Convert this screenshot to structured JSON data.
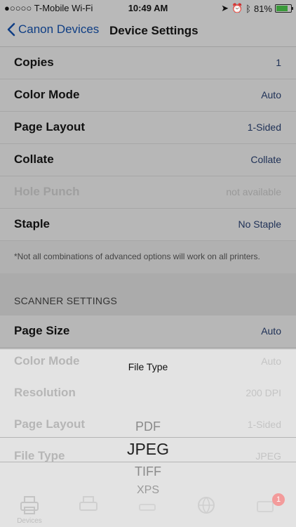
{
  "status_bar": {
    "carrier": "●○○○○ T-Mobile Wi-Fi",
    "time": "10:49 AM",
    "battery": "81%"
  },
  "nav": {
    "back_label": "Canon Devices",
    "title": "Device Settings"
  },
  "printer_rows": [
    {
      "label": "Copies",
      "value": "1"
    },
    {
      "label": "Color Mode",
      "value": "Auto"
    },
    {
      "label": "Page Layout",
      "value": "1-Sided"
    },
    {
      "label": "Collate",
      "value": "Collate"
    },
    {
      "label": "Hole Punch",
      "value": "not available"
    },
    {
      "label": "Staple",
      "value": "No Staple"
    }
  ],
  "note": "*Not all combinations of advanced options will work on all printers.",
  "scanner_section_title": "SCANNER SETTINGS",
  "scanner_rows": [
    {
      "label": "Page Size",
      "value": "Auto"
    },
    {
      "label": "Color Mode",
      "value": "Auto"
    },
    {
      "label": "Resolution",
      "value": "200 DPI"
    },
    {
      "label": "Page Layout",
      "value": "1-Sided"
    },
    {
      "label": "File Type",
      "value": "JPEG"
    }
  ],
  "picker": {
    "title": "File Type",
    "options": [
      "PDF",
      "JPEG",
      "TIFF",
      "XPS"
    ],
    "selected": "JPEG"
  },
  "tabbar": {
    "tabs": [
      {
        "label": "Devices",
        "icon": "printer-icon"
      },
      {
        "label": "",
        "icon": "document-icon"
      },
      {
        "label": "",
        "icon": "scanner-icon"
      },
      {
        "label": "",
        "icon": "globe-icon"
      },
      {
        "label": "",
        "icon": "inbox-icon",
        "badge": "1"
      }
    ]
  }
}
